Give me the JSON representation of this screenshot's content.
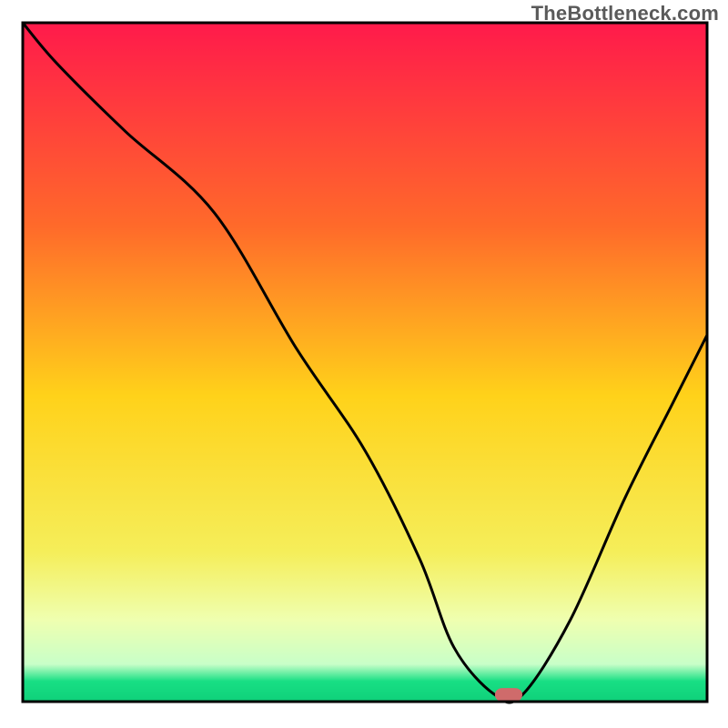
{
  "watermark": "TheBottleneck.com",
  "chart_data": {
    "type": "line",
    "title": "",
    "xlabel": "",
    "ylabel": "",
    "xlim": [
      0,
      100
    ],
    "ylim": [
      0,
      100
    ],
    "x_axis_visible": false,
    "y_axis_visible": false,
    "grid": false,
    "background_gradient_stops": [
      {
        "offset": 0.0,
        "color": "#ff1a4b"
      },
      {
        "offset": 0.3,
        "color": "#ff6a2a"
      },
      {
        "offset": 0.55,
        "color": "#ffd21a"
      },
      {
        "offset": 0.78,
        "color": "#f5ee5a"
      },
      {
        "offset": 0.88,
        "color": "#efffb0"
      },
      {
        "offset": 0.945,
        "color": "#c8ffc8"
      },
      {
        "offset": 0.97,
        "color": "#18df84"
      },
      {
        "offset": 1.0,
        "color": "#0fd07a"
      }
    ],
    "series": [
      {
        "name": "bottleneck-curve",
        "color": "#000000",
        "x": [
          0,
          5,
          15,
          28,
          40,
          50,
          58,
          63,
          69,
          73,
          80,
          88,
          95,
          100
        ],
        "values": [
          100,
          94,
          84,
          72,
          52,
          37,
          21,
          8,
          1,
          1,
          12,
          30,
          44,
          54
        ]
      }
    ],
    "marker": {
      "name": "recommended-point",
      "x": 71,
      "y": 1,
      "color": "#cf6b6b",
      "width": 4,
      "height": 2,
      "shape": "rounded-rect"
    },
    "baseline": {
      "y": 0,
      "color": "#000000"
    },
    "description": "V-shaped curve over a vertical red-to-green gradient. Curve descends steeply from top-left, has a slight knee around x≈28, reaches a flat minimum near x≈63–73, then rises to the right edge. A small rounded pink marker sits at the minimum. The bottom horizontal axis is a thin black line; no tick labels or axis titles are shown."
  }
}
